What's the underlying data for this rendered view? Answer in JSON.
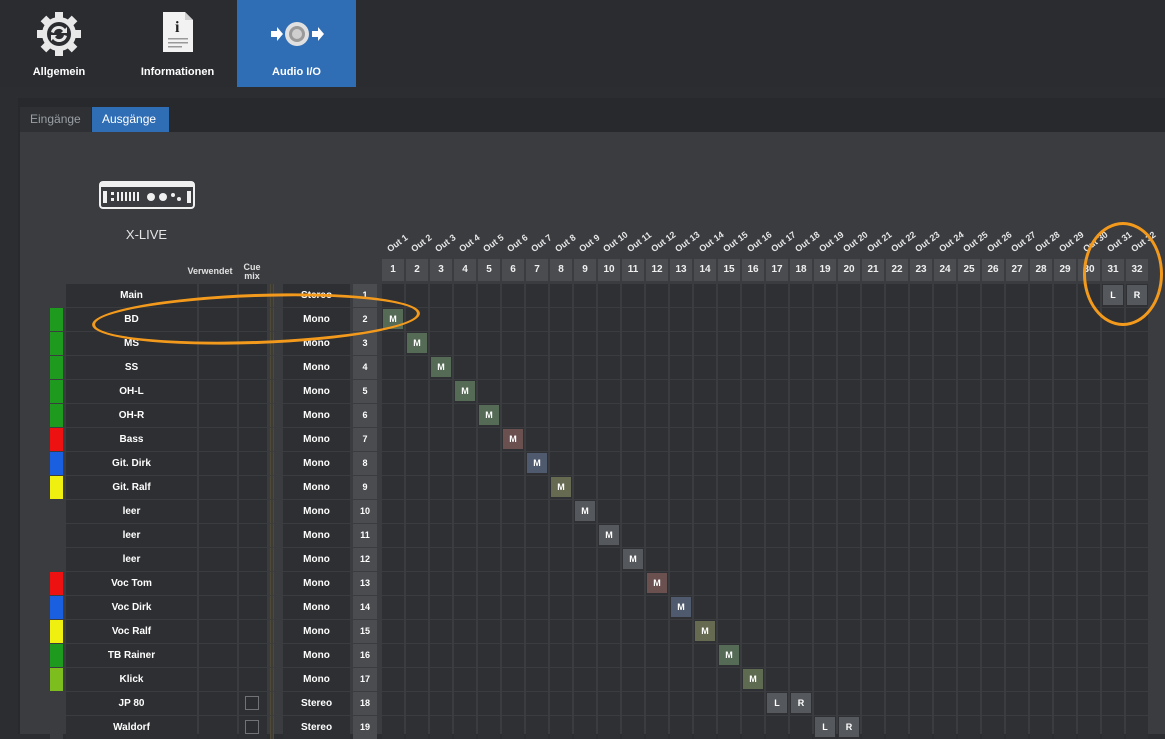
{
  "toolbar": {
    "allgemein": "Allgemein",
    "informationen": "Informationen",
    "audio_io": "Audio I/O"
  },
  "subtabs": {
    "eingaenge": "Eingänge",
    "ausgaenge": "Ausgänge"
  },
  "device": {
    "name": "X-LIVE"
  },
  "headers": {
    "verwendet": "Verwendet",
    "cue_mix": "Cue\nmix"
  },
  "outputs": [
    "Out 1",
    "Out 2",
    "Out 3",
    "Out 4",
    "Out 5",
    "Out 6",
    "Out 7",
    "Out 8",
    "Out 9",
    "Out 10",
    "Out 11",
    "Out 12",
    "Out 13",
    "Out 14",
    "Out 15",
    "Out 16",
    "Out 17",
    "Out 18",
    "Out 19",
    "Out 20",
    "Out 21",
    "Out 22",
    "Out 23",
    "Out 24",
    "Out 25",
    "Out 26",
    "Out 27",
    "Out 28",
    "Out 29",
    "Out 30",
    "Out 31",
    "Out 32"
  ],
  "output_numbers": [
    "1",
    "2",
    "3",
    "4",
    "5",
    "6",
    "7",
    "8",
    "9",
    "10",
    "11",
    "12",
    "13",
    "14",
    "15",
    "16",
    "17",
    "18",
    "19",
    "20",
    "21",
    "22",
    "23",
    "24",
    "25",
    "26",
    "27",
    "28",
    "29",
    "30",
    "31",
    "32"
  ],
  "channels": [
    {
      "name": "Main",
      "color": "#3a3c40",
      "mode": "Stereo",
      "num": "1",
      "assign": [
        {
          "out": 31,
          "label": "L",
          "color": "#55585c"
        },
        {
          "out": 32,
          "label": "R",
          "color": "#55585c"
        }
      ],
      "cue_checkbox": false
    },
    {
      "name": "BD",
      "color": "#1e9a1e",
      "mode": "Mono",
      "num": "2",
      "assign": [
        {
          "out": 1,
          "label": "M",
          "color": "#556b55"
        }
      ],
      "cue_checkbox": false
    },
    {
      "name": "MS",
      "color": "#1e9a1e",
      "mode": "Mono",
      "num": "3",
      "assign": [
        {
          "out": 2,
          "label": "M",
          "color": "#556b55"
        }
      ],
      "cue_checkbox": false
    },
    {
      "name": "SS",
      "color": "#1e9a1e",
      "mode": "Mono",
      "num": "4",
      "assign": [
        {
          "out": 3,
          "label": "M",
          "color": "#556b55"
        }
      ],
      "cue_checkbox": false
    },
    {
      "name": "OH-L",
      "color": "#1e9a1e",
      "mode": "Mono",
      "num": "5",
      "assign": [
        {
          "out": 4,
          "label": "M",
          "color": "#556b55"
        }
      ],
      "cue_checkbox": false
    },
    {
      "name": "OH-R",
      "color": "#1e9a1e",
      "mode": "Mono",
      "num": "6",
      "assign": [
        {
          "out": 5,
          "label": "M",
          "color": "#556b55"
        }
      ],
      "cue_checkbox": false
    },
    {
      "name": "Bass",
      "color": "#ee1111",
      "mode": "Mono",
      "num": "7",
      "assign": [
        {
          "out": 6,
          "label": "M",
          "color": "#6b5050"
        }
      ],
      "cue_checkbox": false
    },
    {
      "name": "Git. Dirk",
      "color": "#1a5fe0",
      "mode": "Mono",
      "num": "8",
      "assign": [
        {
          "out": 7,
          "label": "M",
          "color": "#505a6e"
        }
      ],
      "cue_checkbox": false
    },
    {
      "name": "Git. Ralf",
      "color": "#f0f010",
      "mode": "Mono",
      "num": "9",
      "assign": [
        {
          "out": 8,
          "label": "M",
          "color": "#666a50"
        }
      ],
      "cue_checkbox": false
    },
    {
      "name": "leer",
      "color": "#3a3c40",
      "mode": "Mono",
      "num": "10",
      "assign": [
        {
          "out": 9,
          "label": "M",
          "color": "#55585c"
        }
      ],
      "cue_checkbox": false
    },
    {
      "name": "leer",
      "color": "#3a3c40",
      "mode": "Mono",
      "num": "11",
      "assign": [
        {
          "out": 10,
          "label": "M",
          "color": "#55585c"
        }
      ],
      "cue_checkbox": false
    },
    {
      "name": "leer",
      "color": "#3a3c40",
      "mode": "Mono",
      "num": "12",
      "assign": [
        {
          "out": 11,
          "label": "M",
          "color": "#55585c"
        }
      ],
      "cue_checkbox": false
    },
    {
      "name": "Voc Tom",
      "color": "#ee1111",
      "mode": "Mono",
      "num": "13",
      "assign": [
        {
          "out": 12,
          "label": "M",
          "color": "#6b5050"
        }
      ],
      "cue_checkbox": false
    },
    {
      "name": "Voc Dirk",
      "color": "#1a5fe0",
      "mode": "Mono",
      "num": "14",
      "assign": [
        {
          "out": 13,
          "label": "M",
          "color": "#505a6e"
        }
      ],
      "cue_checkbox": false
    },
    {
      "name": "Voc Ralf",
      "color": "#f0f010",
      "mode": "Mono",
      "num": "15",
      "assign": [
        {
          "out": 14,
          "label": "M",
          "color": "#666a50"
        }
      ],
      "cue_checkbox": false
    },
    {
      "name": "TB Rainer",
      "color": "#1e9a1e",
      "mode": "Mono",
      "num": "16",
      "assign": [
        {
          "out": 15,
          "label": "M",
          "color": "#556b55"
        }
      ],
      "cue_checkbox": false
    },
    {
      "name": "Klick",
      "color": "#7dbd1e",
      "mode": "Mono",
      "num": "17",
      "assign": [
        {
          "out": 16,
          "label": "M",
          "color": "#5e6b50"
        }
      ],
      "cue_checkbox": false
    },
    {
      "name": "JP 80",
      "color": "#3a3c40",
      "mode": "Stereo",
      "num": "18",
      "assign": [
        {
          "out": 17,
          "label": "L",
          "color": "#55585c"
        },
        {
          "out": 18,
          "label": "R",
          "color": "#55585c"
        }
      ],
      "cue_checkbox": true
    },
    {
      "name": "Waldorf",
      "color": "#3a3c40",
      "mode": "Stereo",
      "num": "19",
      "assign": [
        {
          "out": 19,
          "label": "L",
          "color": "#55585c"
        },
        {
          "out": 20,
          "label": "R",
          "color": "#55585c"
        }
      ],
      "cue_checkbox": true
    }
  ],
  "highlight_color": "#f39a1d"
}
